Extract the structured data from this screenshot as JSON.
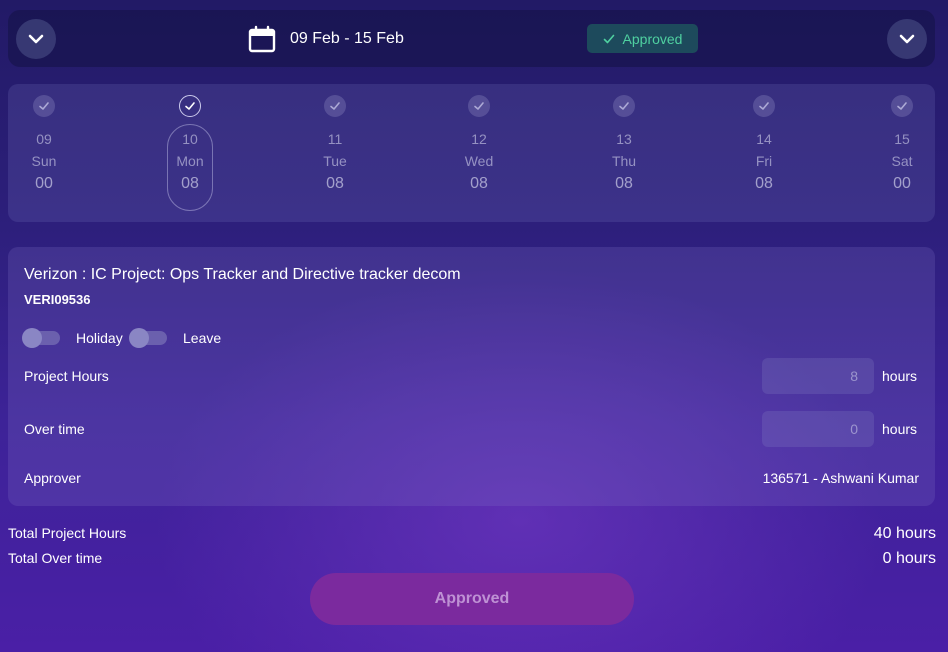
{
  "header": {
    "date_range": "09 Feb - 15 Feb",
    "status": "Approved",
    "icons": {
      "left": "chevron-down-icon",
      "right": "chevron-down-icon",
      "calendar": "calendar-icon",
      "status": "check-icon"
    }
  },
  "week": {
    "selected_index": 1,
    "days": [
      {
        "date": "09",
        "weekday": "Sun",
        "hours": "00"
      },
      {
        "date": "10",
        "weekday": "Mon",
        "hours": "08"
      },
      {
        "date": "11",
        "weekday": "Tue",
        "hours": "08"
      },
      {
        "date": "12",
        "weekday": "Wed",
        "hours": "08"
      },
      {
        "date": "13",
        "weekday": "Thu",
        "hours": "08"
      },
      {
        "date": "14",
        "weekday": "Fri",
        "hours": "08"
      },
      {
        "date": "15",
        "weekday": "Sat",
        "hours": "00"
      }
    ]
  },
  "project": {
    "title": "Verizon : IC Project: Ops Tracker and Directive tracker decom",
    "code": "VERI09536",
    "holiday_label": "Holiday",
    "leave_label": "Leave",
    "holiday_on": false,
    "leave_on": false,
    "project_hours_label": "Project Hours",
    "project_hours_value": "8",
    "overtime_label": "Over time",
    "overtime_value": "0",
    "unit": "hours",
    "approver_label": "Approver",
    "approver_value": "136571 - Ashwani Kumar"
  },
  "totals": {
    "project_hours_label": "Total Project Hours",
    "project_hours_value": "40 hours",
    "overtime_label": "Total Over time",
    "overtime_value": "0 hours"
  },
  "action": {
    "label": "Approved"
  },
  "colors": {
    "status_bg": "#1d4a5c",
    "status_text": "#4fd0a0",
    "button_bg": "#7b2a9e"
  }
}
